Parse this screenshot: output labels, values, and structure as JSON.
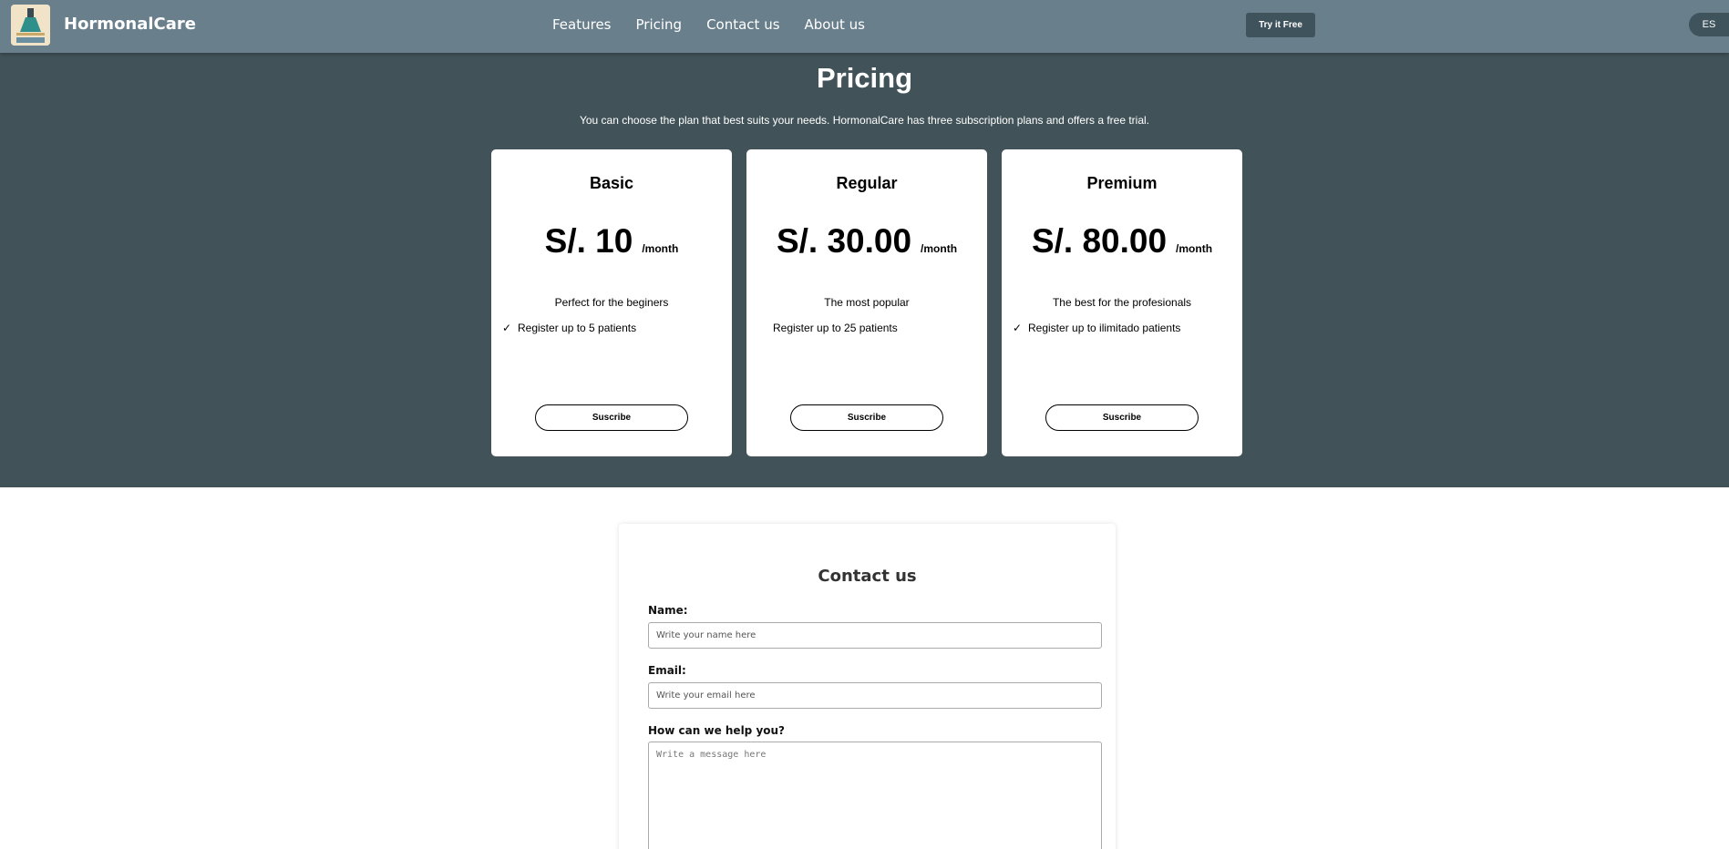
{
  "header": {
    "brand": "HormonalCare",
    "nav": [
      "Features",
      "Pricing",
      "Contact us",
      "About us"
    ],
    "try_label": "Try it Free",
    "lang_label": "ES"
  },
  "pricing": {
    "title": "Pricing",
    "subtitle": "You can choose the plan that best suits your needs. HormonalCare has three subscription plans and offers a free trial.",
    "plans": [
      {
        "name": "Basic",
        "price": "S/. 10",
        "period": "/month",
        "description": "Perfect for the beginers",
        "feature": "Register up to 5 patients",
        "check": "✓",
        "button": "Suscribe"
      },
      {
        "name": "Regular",
        "price": "S/. 30.00",
        "period": "/month",
        "description": "The most popular",
        "feature": "Register up to 25 patients",
        "check": "",
        "button": "Suscribe"
      },
      {
        "name": "Premium",
        "price": "S/. 80.00",
        "period": "/month",
        "description": "The best for the profesionals",
        "feature": "Register up to ilimitado patients",
        "check": "✓",
        "button": "Suscribe"
      }
    ]
  },
  "contact": {
    "title": "Contact us",
    "name_label": "Name:",
    "name_placeholder": "Write your name here",
    "email_label": "Email:",
    "email_placeholder": "Write your email here",
    "message_label": "How can we help you?",
    "message_placeholder": "Write a message here"
  },
  "colors": {
    "header_bg": "#6a7f8c",
    "section_bg": "#415359",
    "button_dark": "#3f535c"
  }
}
